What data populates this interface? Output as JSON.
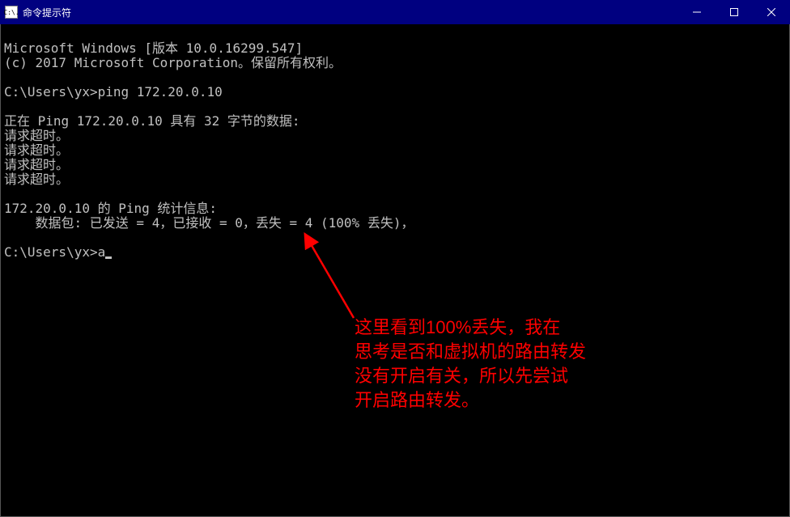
{
  "titlebar": {
    "icon_text": "C:\\.",
    "title": "命令提示符"
  },
  "terminal": {
    "lines": [
      "Microsoft Windows [版本 10.0.16299.547]",
      "(c) 2017 Microsoft Corporation。保留所有权利。",
      "",
      "C:\\Users\\yx>ping 172.20.0.10",
      "",
      "正在 Ping 172.20.0.10 具有 32 字节的数据:",
      "请求超时。",
      "请求超时。",
      "请求超时。",
      "请求超时。",
      "",
      "172.20.0.10 的 Ping 统计信息:",
      "    数据包: 已发送 = 4，已接收 = 0，丢失 = 4 (100% 丢失)，",
      ""
    ],
    "prompt_prefix": "C:\\Users\\yx>",
    "prompt_input": "a"
  },
  "annotation": {
    "text": "这里看到100%丢失，我在\n思考是否和虚拟机的路由转发\n没有开启有关，所以先尝试\n开启路由转发。"
  }
}
